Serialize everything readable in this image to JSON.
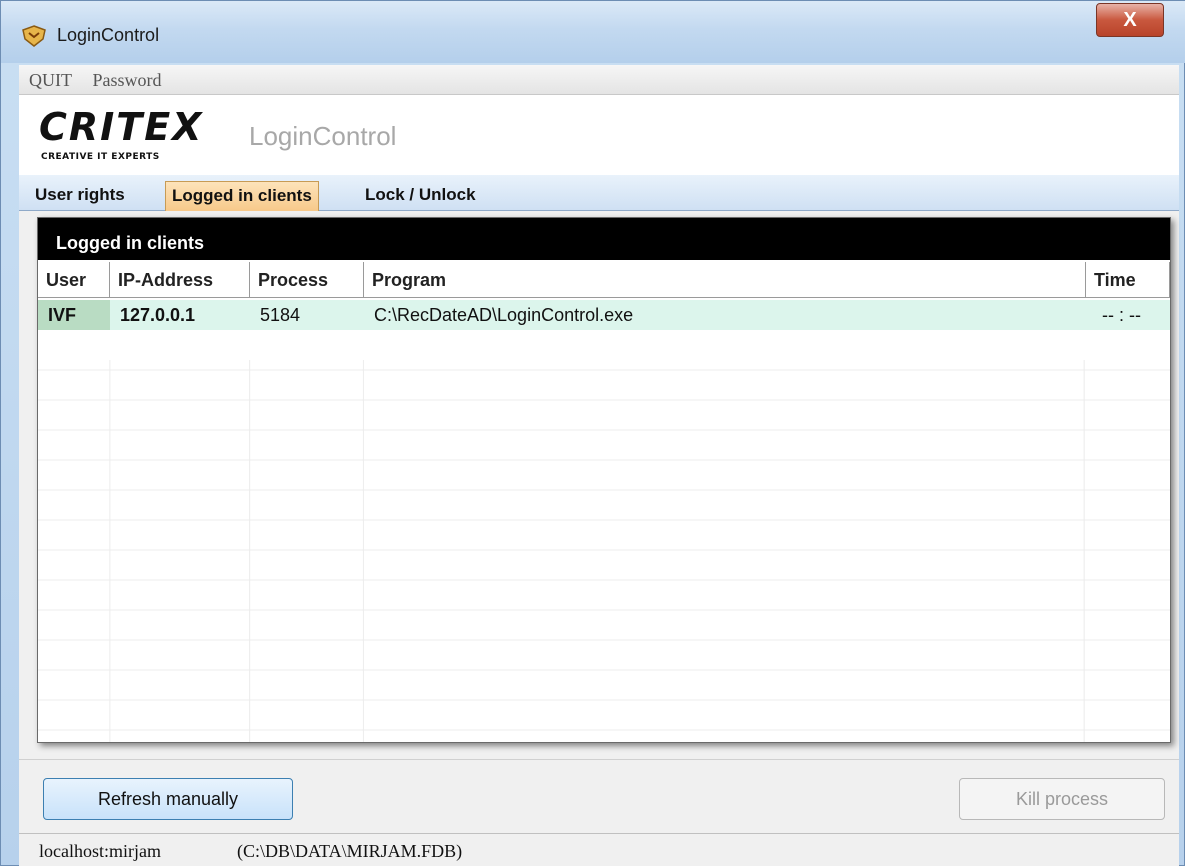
{
  "window": {
    "title": "LoginControl",
    "close_label": "X"
  },
  "menu": {
    "items": [
      "QUIT",
      "Password"
    ]
  },
  "header": {
    "logo_text": "CRITEX",
    "logo_tagline": "CREATIVE IT EXPERTS",
    "app_title": "LoginControl"
  },
  "tabs": [
    {
      "label": "User rights",
      "active": false
    },
    {
      "label": "Logged in clients",
      "active": true
    },
    {
      "label": "Lock / Unlock",
      "active": false
    }
  ],
  "grid": {
    "caption": "Logged in clients",
    "columns": [
      "User",
      "IP-Address",
      "Process",
      "Program",
      "Time"
    ],
    "rows": [
      {
        "user": "IVF",
        "ip": "127.0.0.1",
        "process": "5184",
        "program": "C:\\RecDateAD\\LoginControl.exe",
        "time": "-- : --"
      }
    ]
  },
  "buttons": {
    "refresh": "Refresh manually",
    "kill": "Kill process"
  },
  "status": {
    "host": "localhost:mirjam",
    "database": "(C:\\DB\\DATA\\MIRJAM.FDB)"
  },
  "colors": {
    "active_tab": "#f7c98a",
    "selected_row": "#dcf5ec",
    "grid_caption_bg": "#000000"
  }
}
